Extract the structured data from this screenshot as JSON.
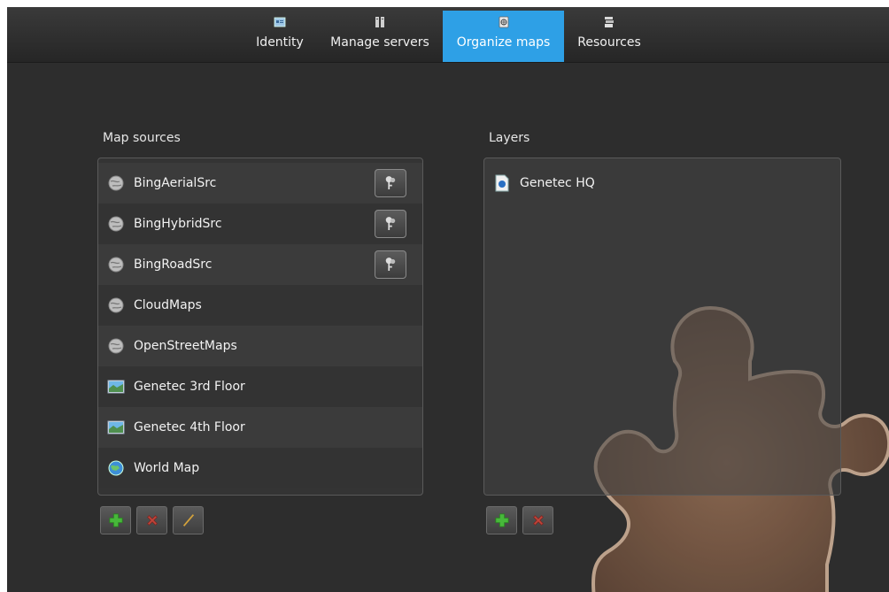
{
  "tabs": [
    {
      "label": "Identity",
      "icon": "identity-icon",
      "active": false
    },
    {
      "label": "Manage servers",
      "icon": "servers-icon",
      "active": false
    },
    {
      "label": "Organize maps",
      "icon": "maps-icon",
      "active": true
    },
    {
      "label": "Resources",
      "icon": "resources-icon",
      "active": false
    }
  ],
  "map_sources": {
    "title": "Map sources",
    "items": [
      {
        "label": "BingAerialSrc",
        "icon": "globe-gray-icon",
        "has_key": true
      },
      {
        "label": "BingHybridSrc",
        "icon": "globe-gray-icon",
        "has_key": true
      },
      {
        "label": "BingRoadSrc",
        "icon": "globe-gray-icon",
        "has_key": true
      },
      {
        "label": "CloudMaps",
        "icon": "globe-gray-icon",
        "has_key": false
      },
      {
        "label": "OpenStreetMaps",
        "icon": "globe-gray-icon",
        "has_key": false
      },
      {
        "label": "Genetec 3rd Floor",
        "icon": "image-map-icon",
        "has_key": false
      },
      {
        "label": "Genetec 4th Floor",
        "icon": "image-map-icon",
        "has_key": false
      },
      {
        "label": "World Map",
        "icon": "globe-color-icon",
        "has_key": false
      }
    ],
    "buttons": [
      "add-icon",
      "delete-icon",
      "edit-icon"
    ]
  },
  "layers": {
    "title": "Layers",
    "items": [
      {
        "label": "Genetec HQ",
        "icon": "layer-document-icon"
      }
    ],
    "buttons": [
      "add-icon",
      "delete-icon"
    ]
  },
  "colors": {
    "accent": "#2ea0e6",
    "background": "#2d2d2d",
    "panel": "#343434",
    "puzzle": "#7a5a44"
  }
}
